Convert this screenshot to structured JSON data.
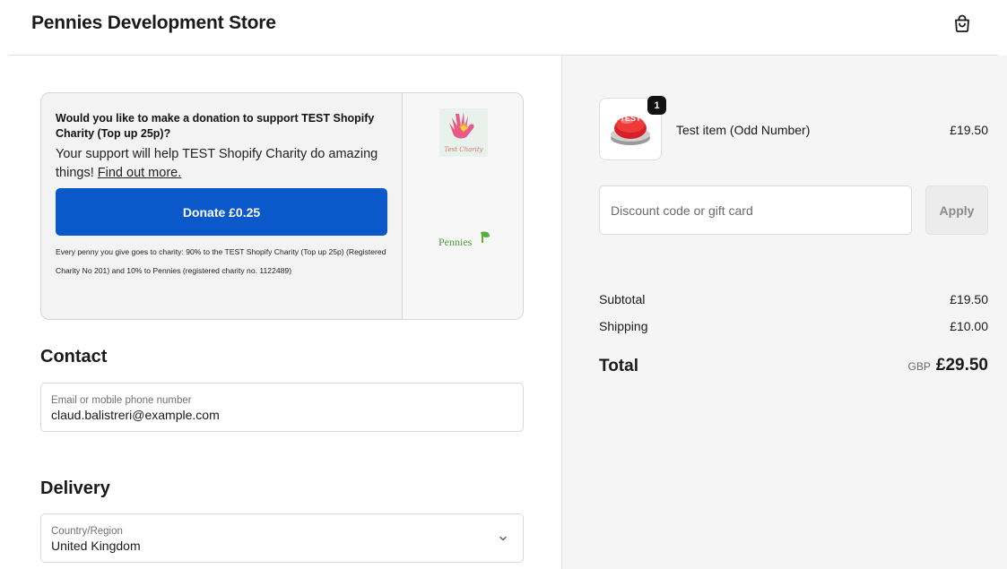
{
  "header": {
    "store_name": "Pennies Development Store",
    "cart_icon": "shopping-bag-icon"
  },
  "donation": {
    "question": "Would you like to make a donation to support TEST Shopify Charity (Top up 25p)?",
    "support_text": "Your support will help TEST Shopify Charity do amazing things!",
    "link_text": "Find out more.",
    "donate_label": "Donate £0.25",
    "fine_print": "Every penny you give goes to charity: 90% to the TEST Shopify Charity (Top up 25p) (Registered Charity No 201) and 10% to Pennies (registered charity no. 1122489)",
    "charity_logo_text": "Test Charity",
    "pennies_logo_text": "Pennies",
    "brand_color": "#0a58c9"
  },
  "contact": {
    "title": "Contact",
    "email_label": "Email or mobile phone number",
    "email_value": "claud.balistreri@example.com"
  },
  "delivery": {
    "title": "Delivery",
    "country_label": "Country/Region",
    "country_value": "United Kingdom"
  },
  "summary": {
    "product": {
      "name": "Test item (Odd Number)",
      "price": "£19.50",
      "quantity": "1",
      "thumb_text": "TEST"
    },
    "discount": {
      "placeholder": "Discount code or gift card",
      "apply_label": "Apply"
    },
    "subtotal_label": "Subtotal",
    "subtotal_value": "£19.50",
    "shipping_label": "Shipping",
    "shipping_value": "£10.00",
    "total_label": "Total",
    "total_currency": "GBP",
    "total_value": "£29.50"
  }
}
